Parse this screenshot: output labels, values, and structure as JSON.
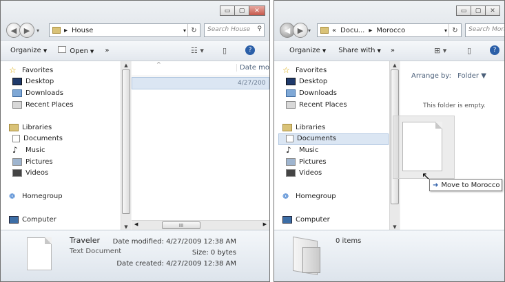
{
  "caption_buttons": {
    "minimize": "▭",
    "maximize": "▢",
    "close": "✕"
  },
  "left_window": {
    "address": {
      "separator": "▸",
      "path": "House"
    },
    "search_placeholder": "Search House",
    "toolbar": {
      "organize": "Organize",
      "open": "Open",
      "more": "»"
    },
    "nav": {
      "favorites": "Favorites",
      "desktop": "Desktop",
      "downloads": "Downloads",
      "recent": "Recent Places",
      "libraries": "Libraries",
      "documents": "Documents",
      "music": "Music",
      "pictures": "Pictures",
      "videos": "Videos",
      "homegroup": "Homegroup",
      "computer": "Computer"
    },
    "column_header": "Date mo",
    "row_date": "4/27/200",
    "hscroll_grip": "III",
    "details": {
      "name": "Traveler",
      "type": "Text Document",
      "modified": "Date modified: 4/27/2009 12:38 AM",
      "size": "Size: 0 bytes",
      "created": "Date created: 4/27/2009 12:38 AM"
    }
  },
  "right_window": {
    "address": {
      "prefix": "«",
      "seg1": "Docu...",
      "separator": "▸",
      "seg2": "Morocco"
    },
    "search_placeholder": "Search Mora...",
    "toolbar": {
      "organize": "Organize",
      "share": "Share with",
      "more": "»"
    },
    "nav": {
      "favorites": "Favorites",
      "desktop": "Desktop",
      "downloads": "Downloads",
      "recent": "Recent Places",
      "libraries": "Libraries",
      "documents": "Documents",
      "music": "Music",
      "pictures": "Pictures",
      "videos": "Videos",
      "homegroup": "Homegroup",
      "computer": "Computer"
    },
    "arrange_label": "Arrange by:",
    "arrange_value": "Folder",
    "empty_text": "This folder is empty.",
    "item_count": "0 items"
  },
  "drag_tooltip": "Move to Morocco",
  "icons": [
    "star-icon",
    "desktop-icon",
    "downloads-icon",
    "recent-places-icon",
    "libraries-icon",
    "documents-icon",
    "music-icon",
    "pictures-icon",
    "videos-icon",
    "homegroup-icon",
    "computer-icon",
    "search-icon",
    "refresh-icon",
    "help-icon",
    "view-icon",
    "preview-pane-icon",
    "cursor-icon"
  ],
  "colors": {
    "selection": "#dbe6f3",
    "title_bar": "#dfe4e9",
    "close_button": "#c5574a"
  }
}
